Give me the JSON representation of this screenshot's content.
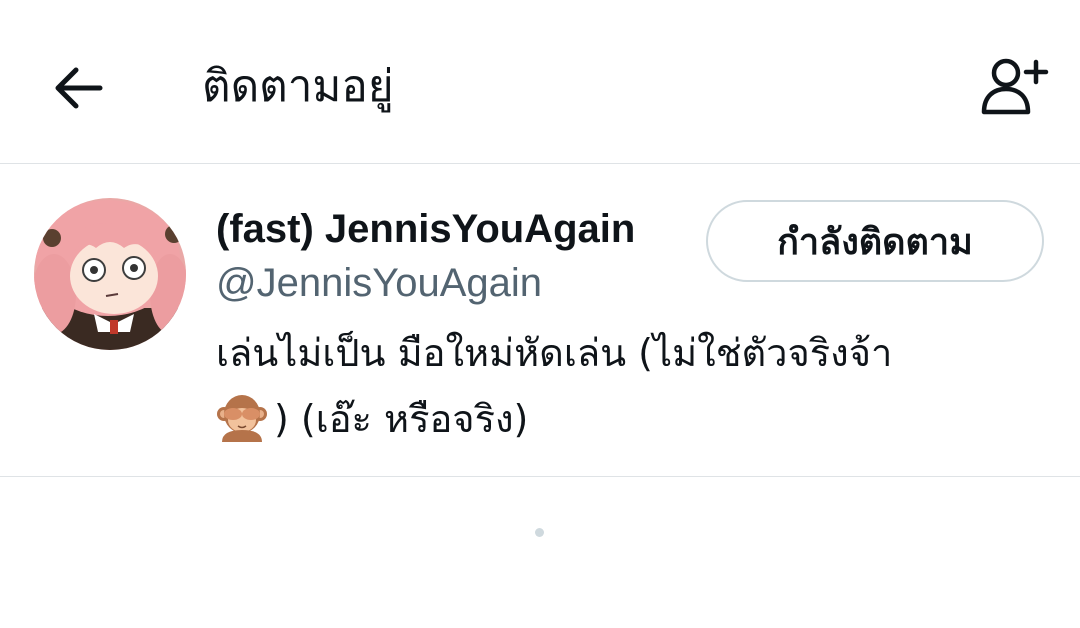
{
  "header": {
    "title": "ติดตามอยู่",
    "back_icon": "arrow-left-icon",
    "add_user_icon": "person-plus-icon"
  },
  "user": {
    "display_name": "(fast) JennisYouAgain",
    "handle": "@JennisYouAgain",
    "follow_button_label": "กำลังติดตาม",
    "bio_line1": "เล่นไม่เป็น มือใหม่หัดเล่น (ไม่ใช่ตัวจริงจ้า",
    "bio_emoji": "see-no-evil-monkey-icon",
    "bio_line2_text": ") (เอ๊ะ หรือจริง)"
  },
  "colors": {
    "text_primary": "#0f1419",
    "text_secondary": "#536471",
    "border": "#dfe3e6",
    "button_border": "#cfd9de"
  }
}
